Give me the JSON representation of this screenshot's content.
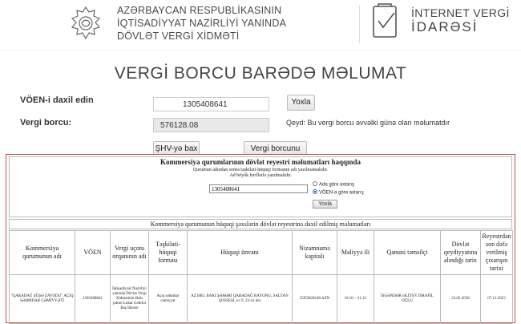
{
  "header": {
    "org_line1": "AZƏRBAYCAN RESPUBLİKASININ",
    "org_line2": "İQTİSADİYYAT NAZİRLİYİ YANINDA",
    "org_line3": "DÖVLƏT VERGİ XİDMƏTİ",
    "portal_line1": "İNTERNET VERGİ",
    "portal_line2": "İDARƏSİ"
  },
  "page_title": "VERGİ BORCU BARƏDƏ MƏLUMAT",
  "form": {
    "voen_label": "VÖEN-i daxil edin",
    "voen_value": "1305408641",
    "yoxla_label": "Yoxla",
    "debt_label": "Vergi borcu:",
    "debt_value": "576128.08",
    "note": "Qeyd: Bu vergi borcu əvvəlki günə olan məlumatdır",
    "shv_button": "ŞHV-yə bax",
    "pay_button": "Vergi borcunu ödə"
  },
  "registry": {
    "title": "Kommersiya qurumlarının dövlət reyestri məlumatları haqqında",
    "subtitle1": "Qurumun adından sonra təşkilati-hüquqi formanın adı yazılmamalıdır.",
    "subtitle2": "Ad böyük hərflərlə yazılmalıdır.",
    "input_value": "1305408641",
    "radio_name": "Ada görə axtarış",
    "radio_voen": "VÖEN-ə görə axtarış",
    "button": "Yoxla",
    "table_title": "Kommersiya qurumunun hüquqi şəxslərin dövlət reyestrinə daxil edilmiş məlumatları",
    "columns": [
      "Kommersiya qurumunun adı",
      "VÖEN",
      "Vergi uçotu orqanının adı",
      "Təşkilati-hüquqi forması",
      "Hüquqi ünvanı",
      "Nizamnamə kapitalı",
      "Maliyyə ili",
      "Qanuni təmsilçi",
      "Dövlət qeydiyyatına alındığı tarix",
      "Reyestrdən son dəfə verilmiş çıxarışın tarixi"
    ],
    "rows": [
      [
        "\"QARADAĞ ŞÜŞƏ ZAVODU\" AÇIQ SƏHMDAR CƏMİYYƏTİ",
        "1305408641",
        "İqtisadiyyat Nazirliyi yanında Dövlət Vergi Xidmətinin Bakı şəhəri Lokal Gəlirlər Baş İdarəsi",
        "Açıq səhmdar cəmiyyət",
        "AZ1083, BAKI ŞƏHƏRİ QARADAĞ RAYONU, SALYAN ŞOSSESİ, ev 9, 23-cü km",
        "35950630.00 AZN",
        "01.01 - 31.12",
        "İSGƏNDƏR ƏLİYEV İSRAFİL OĞLU",
        "23.02.2018",
        "07.12.2023"
      ]
    ]
  }
}
